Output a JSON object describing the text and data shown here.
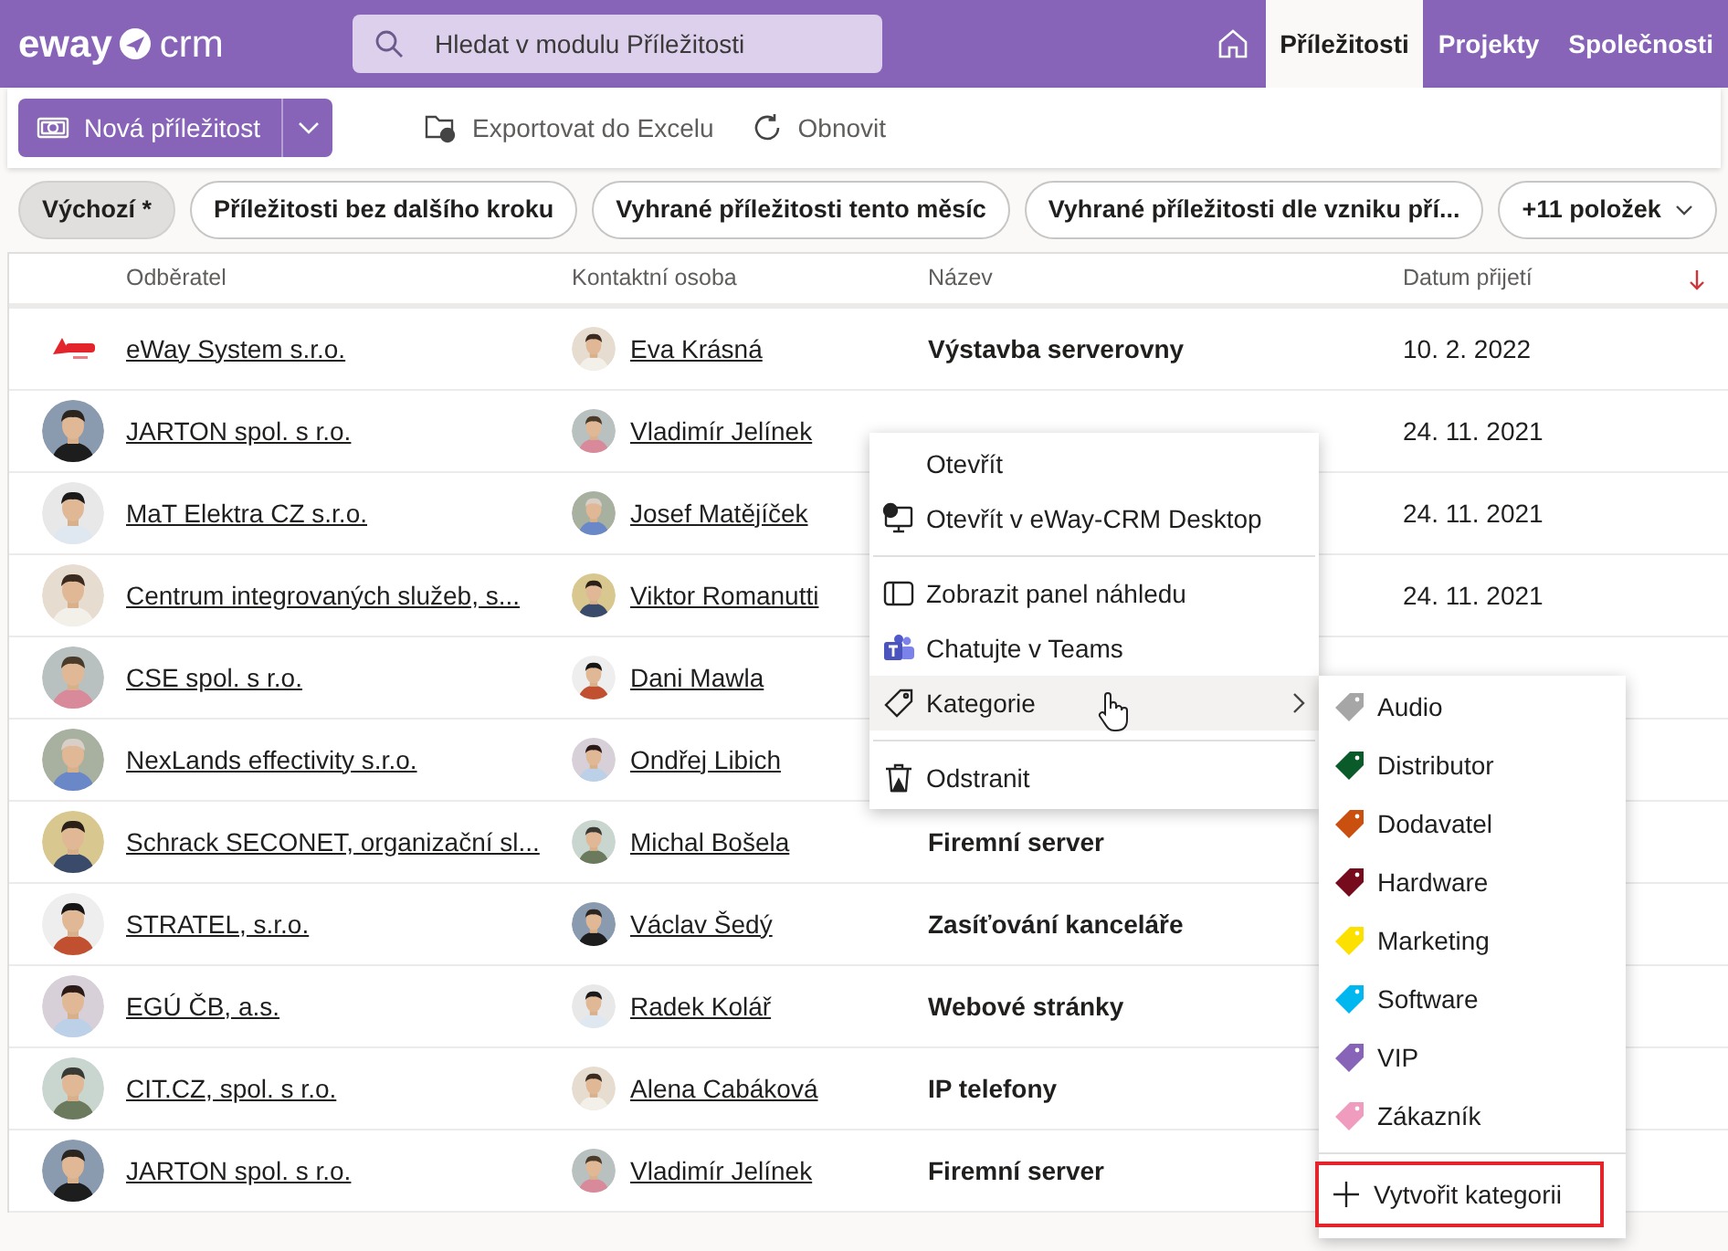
{
  "top_bar": {
    "logo_left": "eway",
    "logo_right": "crm",
    "search": {
      "placeholder": "Hledat v modulu Příležitosti"
    },
    "nav": [
      {
        "label": "Příležitosti",
        "selected": true
      },
      {
        "label": "Projekty",
        "selected": false
      },
      {
        "label": "Společnosti",
        "selected": false
      }
    ]
  },
  "toolbar": {
    "new_button": "Nová příležitost",
    "actions": [
      {
        "label": "Exportovat do Excelu",
        "kind": "export"
      },
      {
        "label": "Obnovit",
        "kind": "refresh"
      }
    ]
  },
  "filters": [
    {
      "label": "Výchozí *",
      "selected": true,
      "dropdown": false
    },
    {
      "label": "Příležitosti bez dalšího kroku",
      "selected": false,
      "dropdown": false
    },
    {
      "label": "Vyhrané příležitosti tento měsíc",
      "selected": false,
      "dropdown": false
    },
    {
      "label": "Vyhrané příležitosti dle vzniku pří...",
      "selected": false,
      "dropdown": false
    },
    {
      "label": "+11 položek",
      "selected": false,
      "dropdown": true
    }
  ],
  "table": {
    "columns": [
      "Odběratel",
      "Kontaktní osoba",
      "Název",
      "Datum přijetí"
    ],
    "sort_descending": true,
    "rows": [
      {
        "customer": "eWay System s.r.o.",
        "kind": "logo",
        "contact": "Eva Krásná",
        "name": "Výstavba serverovny",
        "date": "10. 2. 2022"
      },
      {
        "customer": "JARTON spol. s r.o.",
        "contact": "Vladimír Jelínek",
        "date": "24. 11. 2021"
      },
      {
        "customer": "MaT Elektra CZ s.r.o.",
        "contact": "Josef Matějíček",
        "date": "24. 11. 2021"
      },
      {
        "customer": "Centrum integrovaných služeb, s...",
        "contact": "Viktor Romanutti",
        "date": "24. 11. 2021"
      },
      {
        "customer": "CSE spol. s r.o.",
        "contact": "Dani Mawla"
      },
      {
        "customer": "NexLands effectivity s.r.o.",
        "contact": "Ondřej Libich"
      },
      {
        "customer": "Schrack SECONET, organizační sl...",
        "contact": "Michal Bošela",
        "name": "Firemní server"
      },
      {
        "customer": "STRATEL, s.r.o.",
        "contact": "Václav Šedý",
        "name": "Zasíťování kanceláře"
      },
      {
        "customer": "EGÚ ČB, a.s.",
        "contact": "Radek Kolář",
        "name": "Webové stránky"
      },
      {
        "customer": "CIT.CZ, spol. s r.o.",
        "contact": "Alena Cabáková",
        "name": "IP telefony"
      },
      {
        "customer": "JARTON spol. s r.o.",
        "contact": "Vladimír Jelínek",
        "name": "Firemní server"
      }
    ]
  },
  "context_menu": {
    "items": [
      {
        "kind": "plain",
        "label": "Otevřít",
        "highlighted": false
      },
      {
        "kind": "desktop",
        "label": "Otevřít v eWay-CRM Desktop",
        "highlighted": false
      },
      {
        "kind": "divider"
      },
      {
        "kind": "panel",
        "label": "Zobrazit panel náhledu",
        "highlighted": false
      },
      {
        "kind": "teams",
        "label": "Chatujte v Teams",
        "highlighted": false
      },
      {
        "kind": "tag",
        "label": "Kategorie",
        "highlighted": true,
        "submenu": true
      },
      {
        "kind": "divider"
      },
      {
        "kind": "trash",
        "label": "Odstranit",
        "highlighted": false
      }
    ]
  },
  "category_submenu": {
    "categories": [
      {
        "label": "Audio",
        "color": "#a6a6a6"
      },
      {
        "label": "Distributor",
        "color": "#0b5a2a"
      },
      {
        "label": "Dodavatel",
        "color": "#ca5010"
      },
      {
        "label": "Hardware",
        "color": "#750b1c"
      },
      {
        "label": "Marketing",
        "color": "#fce100"
      },
      {
        "label": "Software",
        "color": "#00b7f0"
      },
      {
        "label": "VIP",
        "color": "#8764b8"
      },
      {
        "label": "Zákazník",
        "color": "#f09cbf"
      }
    ],
    "create": {
      "label": "Vytvořit kategorii",
      "outlined": true
    }
  }
}
